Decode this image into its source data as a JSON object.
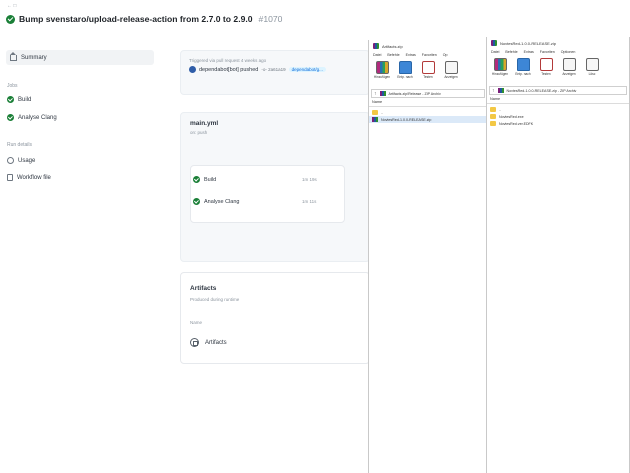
{
  "header": {
    "back": "← □",
    "title": "Bump svenstaro/upload-release-action from 2.7.0 to 2.9.0",
    "run_number": "#1070"
  },
  "sidebar": {
    "summary": "Summary",
    "jobs_section": "Jobs",
    "jobs": [
      "Build",
      "Analyse Clang"
    ],
    "run_details_section": "Run details",
    "details": [
      "Usage",
      "Workflow file"
    ]
  },
  "trigger": {
    "label": "Triggered via pull request 4 weeks ago",
    "actor": "dependabot[bot] pushed",
    "sha": "-o- 2a61a19",
    "branch": "dependabot/g..."
  },
  "workflow": {
    "name": "main.yml",
    "on": "on: push",
    "jobs": [
      {
        "name": "Build",
        "duration": "1m 19s"
      },
      {
        "name": "Analyse Clang",
        "duration": "1m 11s"
      }
    ]
  },
  "artifacts": {
    "title": "Artifacts",
    "subtitle": "Produced during runtime",
    "column": "Name",
    "item": "Artifacts"
  },
  "window1": {
    "title": "Artifacts.zip",
    "menu": [
      "Datei",
      "Befehle",
      "Extras",
      "Favoriten",
      "Op"
    ],
    "tools": [
      "Hinzufügen",
      "Entp. nach",
      "Testen",
      "Anzeigen"
    ],
    "path": "Artifacts.zip\\Release - ZIP Archiv",
    "column": "Name",
    "rows": [
      "..",
      "NovtesRed-1.0.0-RELEASE.zip"
    ]
  },
  "window2": {
    "title": "NovtesRed-1.0.0-RELEASE.zip",
    "menu": [
      "Datei",
      "Befehle",
      "Extras",
      "Favoriten",
      "Optionen"
    ],
    "tools": [
      "Hinzufügen",
      "Entp. nach",
      "Testen",
      "Anzeigen",
      "Lösc"
    ],
    "path": "NovtesRed-1.0.0-RELEASE.zip - ZIP Archiv",
    "column": "Name",
    "rows": [
      "..",
      "NovtesRed.exe",
      "NovtesRed.ver.EDFK"
    ]
  }
}
